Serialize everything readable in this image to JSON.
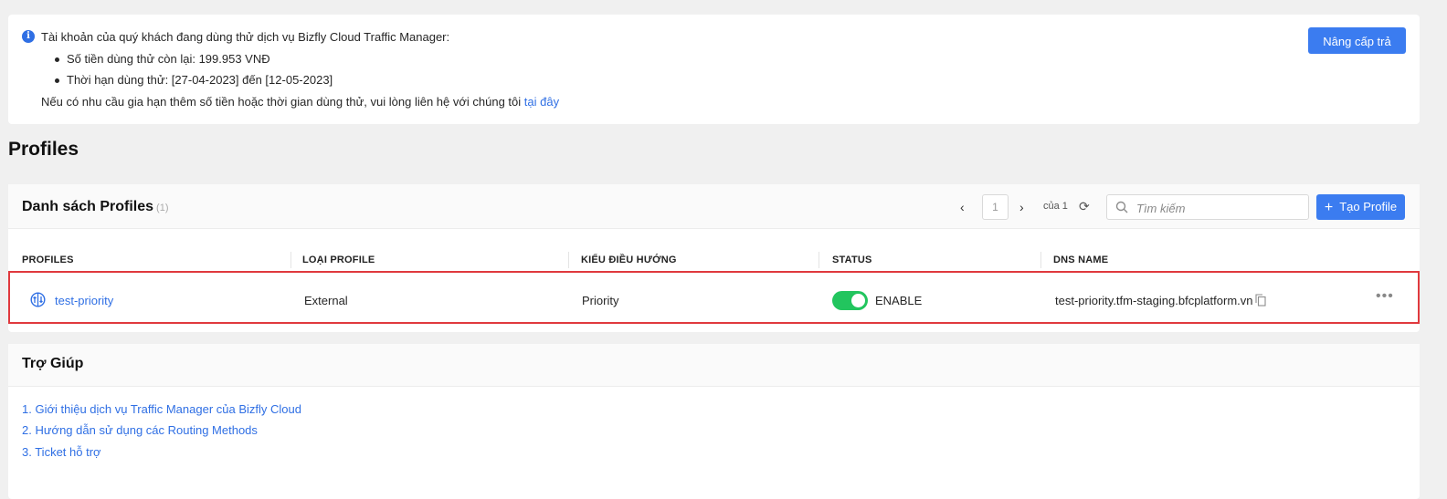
{
  "notice": {
    "title": "Tài khoản của quý khách đang dùng thử dịch vụ Bizfly Cloud Traffic Manager:",
    "items": [
      "Số tiền dùng thử còn lại: 199.953 VNĐ",
      "Thời hạn dùng thử: [27-04-2023] đến [12-05-2023]"
    ],
    "contact_text": "Nếu có nhu cầu gia hạn thêm số tiền hoặc thời gian dùng thử, vui lòng liên hệ với chúng tôi",
    "contact_link": "tại đây",
    "upgrade_button": "Nâng cấp trả phí",
    "info_icon": "i"
  },
  "page_title": "Profiles",
  "profiles_card": {
    "title": "Danh sách Profiles",
    "count": "(1)",
    "pagination": {
      "prev": "‹",
      "next": "›",
      "current_page": "1",
      "of_text": "của 1"
    },
    "refresh_icon": "⟳",
    "search_placeholder": "Tìm kiếm",
    "create_button": "Tạo Profile",
    "create_icon": "+",
    "columns": [
      "PROFILES",
      "LOẠI PROFILE",
      "KIỂU ĐIỀU HƯỚNG",
      "STATUS",
      "DNS NAME"
    ],
    "rows": [
      {
        "name": "test-priority",
        "type": "External",
        "routing": "Priority",
        "status": "ENABLE",
        "status_on": true,
        "dns_name": "test-priority.tfm-staging.bfcplatform.vn",
        "more": "•••"
      }
    ]
  },
  "help": {
    "title": "Trợ Giúp",
    "links": [
      "1. Giới thiệu dịch vụ Traffic Manager của Bizfly Cloud",
      "2. Hướng dẫn sử dụng các Routing Methods",
      "3. Ticket hỗ trợ"
    ]
  },
  "colors": {
    "primary": "#3b7cf0",
    "link": "#2f6fe4",
    "toggle_on": "#22c55e",
    "highlight_border": "#e0393e"
  }
}
